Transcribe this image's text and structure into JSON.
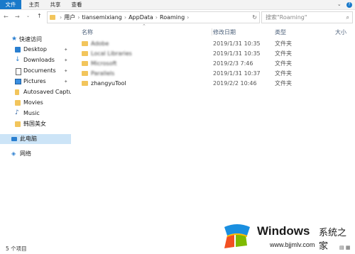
{
  "ribbon": {
    "tabs": [
      "文件",
      "主页",
      "共享",
      "查看"
    ],
    "help_icon": "help-icon",
    "accent": "#1979ca"
  },
  "address": {
    "crumbs": [
      "用户",
      "tiansemixiang",
      "AppData",
      "Roaming"
    ],
    "search_placeholder": "搜索\"Roaming\""
  },
  "sidebar": {
    "quick_access": "快速访问",
    "items": [
      {
        "label": "Desktop",
        "pinned": true
      },
      {
        "label": "Downloads",
        "pinned": true
      },
      {
        "label": "Documents",
        "pinned": true
      },
      {
        "label": "Pictures",
        "pinned": true
      },
      {
        "label": "Autosaved Capture",
        "pinned": false
      },
      {
        "label": "Movies",
        "pinned": false
      },
      {
        "label": "Music",
        "pinned": false
      },
      {
        "label": "韩国美女",
        "pinned": false
      }
    ],
    "this_pc": "此电脑",
    "network": "网络"
  },
  "columns": {
    "name": "名称",
    "date": "修改日期",
    "type": "类型",
    "size": "大小"
  },
  "files": [
    {
      "name": "Adobe",
      "date": "2019/1/31 10:35",
      "type": "文件夹",
      "blurred": true
    },
    {
      "name": "Local Libraries",
      "date": "2019/1/31 10:35",
      "type": "文件夹",
      "blurred": true
    },
    {
      "name": "Microsoft",
      "date": "2019/2/3 7:46",
      "type": "文件夹",
      "blurred": true
    },
    {
      "name": "Parallels",
      "date": "2019/1/31 10:37",
      "type": "文件夹",
      "blurred": true
    },
    {
      "name": "zhangyuTool",
      "date": "2019/2/2 10:46",
      "type": "文件夹",
      "blurred": false
    }
  ],
  "status": {
    "count": "5 个项目"
  },
  "watermark": {
    "brand": "Windows",
    "suffix": "系统之家",
    "url": "www.bjjmlv.com"
  }
}
